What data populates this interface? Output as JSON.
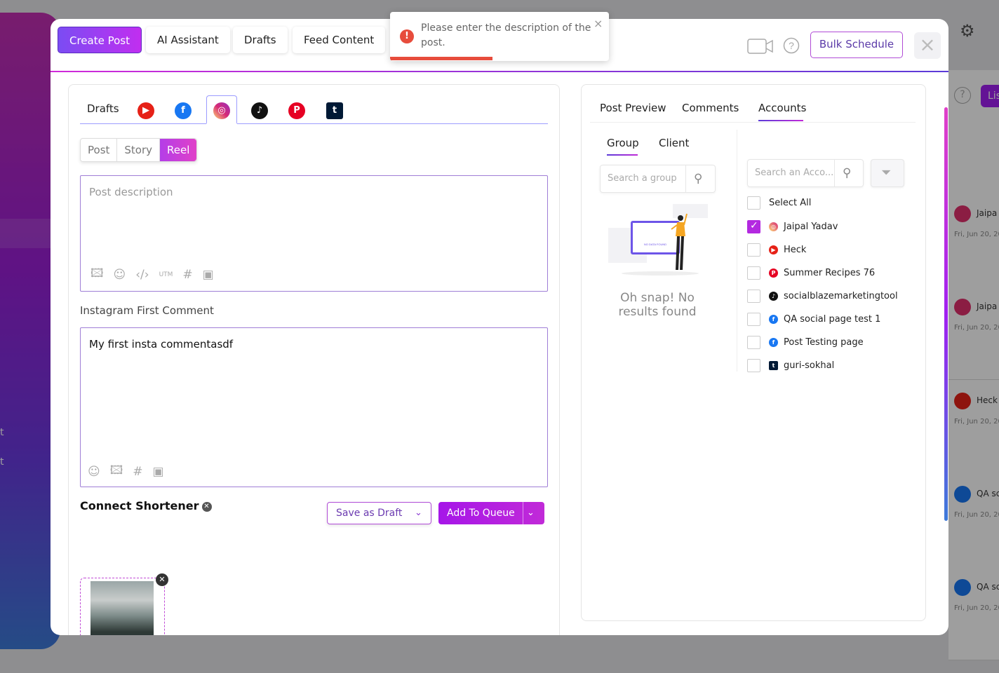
{
  "toolbar": {
    "tabs": [
      "Create Post",
      "AI Assistant",
      "Drafts",
      "Feed Content"
    ],
    "bulk_schedule": "Bulk Schedule",
    "close": "×"
  },
  "toast": {
    "message": "Please enter the description of the post.",
    "close": "×",
    "icon": "!"
  },
  "editor": {
    "platform_tabs": {
      "drafts": "Drafts"
    },
    "post_types": [
      "Post",
      "Story",
      "Reel"
    ],
    "selected_post_type": "Reel",
    "description_placeholder": "Post description",
    "first_comment_label": "Instagram First Comment",
    "first_comment_value": "My first insta commentasdf",
    "shortener_label": "Connect Shortener",
    "save_draft_label": "Save as Draft",
    "add_queue_label": "Add To Queue",
    "utm_label": "UTM"
  },
  "preview": {
    "tabs": [
      "Post Preview",
      "Comments",
      "Accounts"
    ],
    "active_tab": "Accounts",
    "group_tabs": [
      "Group",
      "Client"
    ],
    "group_search_placeholder": "Search a group",
    "account_search_placeholder": "Search an Acco...",
    "no_results": "Oh snap! No results found",
    "illustration_text": "NO DATA FOUND",
    "select_all": "Select All",
    "accounts": [
      {
        "name": "Jaipal Yadav",
        "platform": "instagram",
        "checked": true
      },
      {
        "name": "Heck",
        "platform": "youtube",
        "checked": false
      },
      {
        "name": "Summer Recipes 76",
        "platform": "pinterest",
        "checked": false
      },
      {
        "name": "socialblazemarketingtool",
        "platform": "tiktok",
        "checked": false
      },
      {
        "name": "QA social page test 1",
        "platform": "facebook",
        "checked": false
      },
      {
        "name": "Post Testing page",
        "platform": "facebook",
        "checked": false
      },
      {
        "name": "guri-sokhal",
        "platform": "tumblr",
        "checked": false
      }
    ]
  },
  "background": {
    "list_button": "Lis",
    "sidebar_texts": [
      "t",
      "t"
    ],
    "cards": [
      {
        "name": "Jaipa",
        "date": "Fri, Jun 20, 20",
        "platform": "instagram"
      },
      {
        "name": "Jaipa",
        "date": "Fri, Jun 20, 20",
        "platform": "instagram"
      },
      {
        "name": "Heck",
        "date": "Fri, Jun 20, 20",
        "platform": "youtube"
      },
      {
        "name": "QA sc",
        "date": "Fri, Jun 20, 20",
        "platform": "facebook"
      },
      {
        "name": "QA sc",
        "date": "Fri, Jun 20, 20",
        "platform": "facebook"
      }
    ]
  },
  "colors": {
    "accent": "#b329e0",
    "error": "#e74c3c",
    "youtube": "#e62117",
    "facebook": "#1877f2",
    "pinterest": "#e60023",
    "tiktok": "#111111",
    "tumblr": "#001935"
  }
}
